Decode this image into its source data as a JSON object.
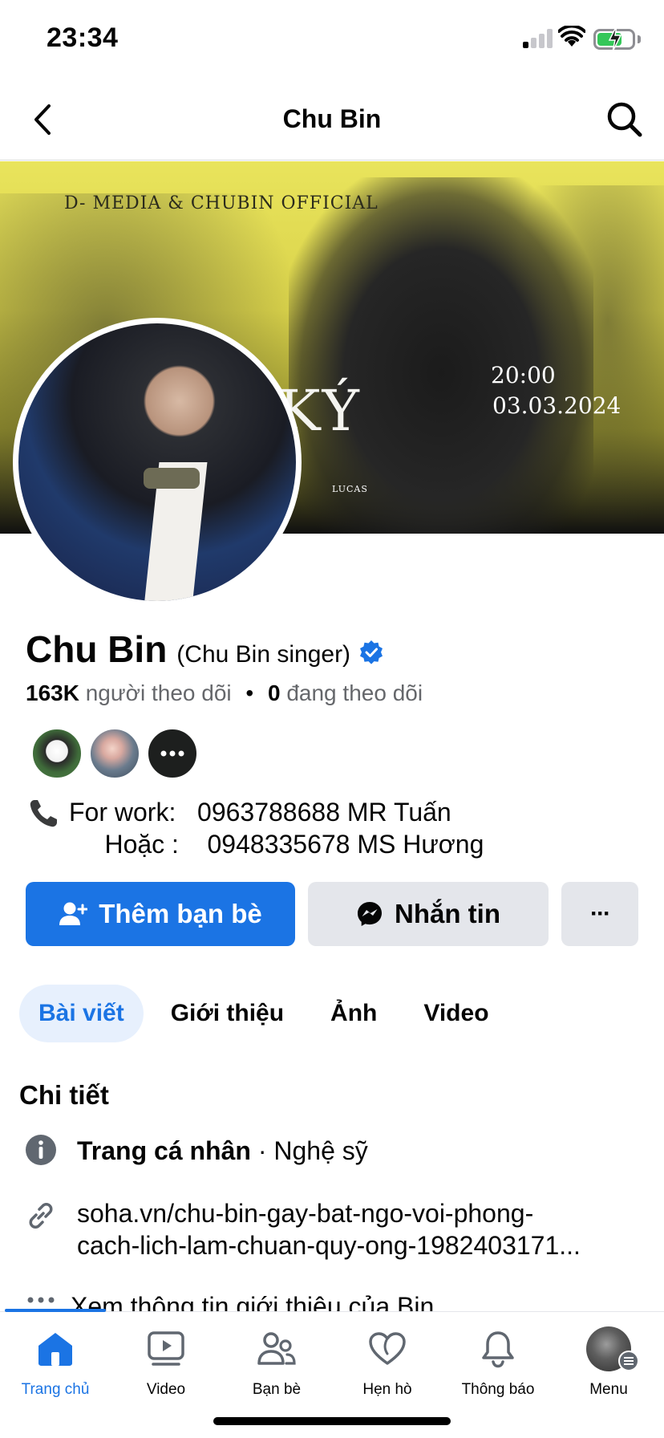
{
  "status_bar": {
    "time": "23:34"
  },
  "header": {
    "title": "Chu Bin"
  },
  "cover": {
    "brand_text": "D- MEDIA & CHUBIN OFFICIAL",
    "big_title": "U KÝ",
    "time": "20:00",
    "date": "03.03.2024",
    "sponsor": "LUCAS"
  },
  "profile": {
    "name": "Chu Bin",
    "alt_name": "(Chu Bin singer)",
    "followers_count": "163K",
    "followers_label": "người theo dõi",
    "separator": "•",
    "following_count": "0",
    "following_label": "đang theo dõi",
    "bio_line1": "For work:   0963788688 MR Tuấn",
    "bio_line2": "     Hoặc :    0948335678 MS Hương"
  },
  "actions": {
    "add_friend": "Thêm bạn bè",
    "message": "Nhắn tin",
    "more": "···"
  },
  "tabs": [
    {
      "label": "Bài viết",
      "active": true
    },
    {
      "label": "Giới thiệu",
      "active": false
    },
    {
      "label": "Ảnh",
      "active": false
    },
    {
      "label": "Video",
      "active": false
    }
  ],
  "details": {
    "title": "Chi tiết",
    "page_type_bold": "Trang cá nhân",
    "page_type_rest": " · Nghệ sỹ",
    "link_line1": "soha.vn/chu-bin-gay-bat-ngo-voi-phong-",
    "link_line2": "cach-lich-lam-chuan-quy-ong-1982403171...",
    "see_more": "Xem thông tin giới thiệu của Bin"
  },
  "tabbar": [
    {
      "label": "Trang chủ",
      "icon": "home-icon",
      "active": true
    },
    {
      "label": "Video",
      "icon": "video-icon",
      "active": false
    },
    {
      "label": "Bạn bè",
      "icon": "friends-icon",
      "active": false
    },
    {
      "label": "Hẹn hò",
      "icon": "dating-icon",
      "active": false
    },
    {
      "label": "Thông báo",
      "icon": "bell-icon",
      "active": false
    },
    {
      "label": "Menu",
      "icon": "menu-avatar",
      "active": false
    }
  ],
  "colors": {
    "accent": "#1b74e4",
    "secondary_button": "#e4e6eb",
    "muted_text": "#65676b",
    "active_tab_bg": "#e7f0fd"
  }
}
